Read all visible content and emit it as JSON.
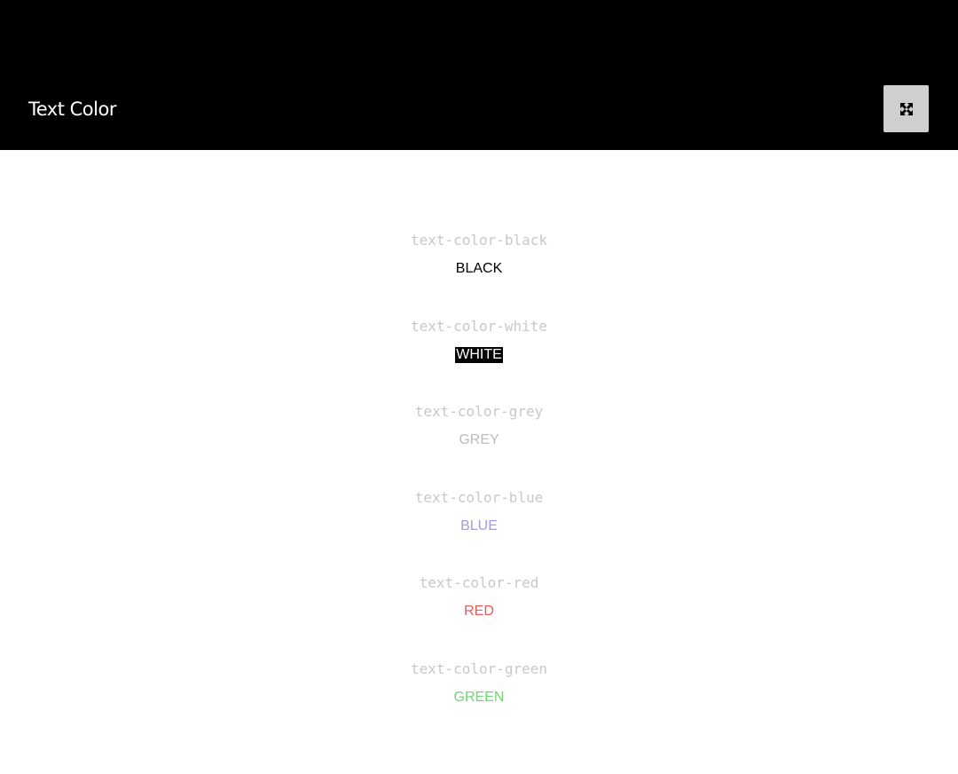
{
  "header": {
    "title": "Text Color",
    "fullscreen_icon": "expand-arrows-icon"
  },
  "swatches": [
    {
      "class_name": "text-color-black",
      "label": "BLACK",
      "color": "#000000",
      "background": "transparent"
    },
    {
      "class_name": "text-color-white",
      "label": "WHITE",
      "color": "#ffffff",
      "background": "#000000"
    },
    {
      "class_name": "text-color-grey",
      "label": "GREY",
      "color": "#bdbdbd",
      "background": "transparent"
    },
    {
      "class_name": "text-color-blue",
      "label": "BLUE",
      "color": "#a79be0",
      "background": "transparent"
    },
    {
      "class_name": "text-color-red",
      "label": "RED",
      "color": "#ec5a5a",
      "background": "transparent"
    },
    {
      "class_name": "text-color-green",
      "label": "GREEN",
      "color": "#6fd56f",
      "background": "transparent"
    }
  ]
}
